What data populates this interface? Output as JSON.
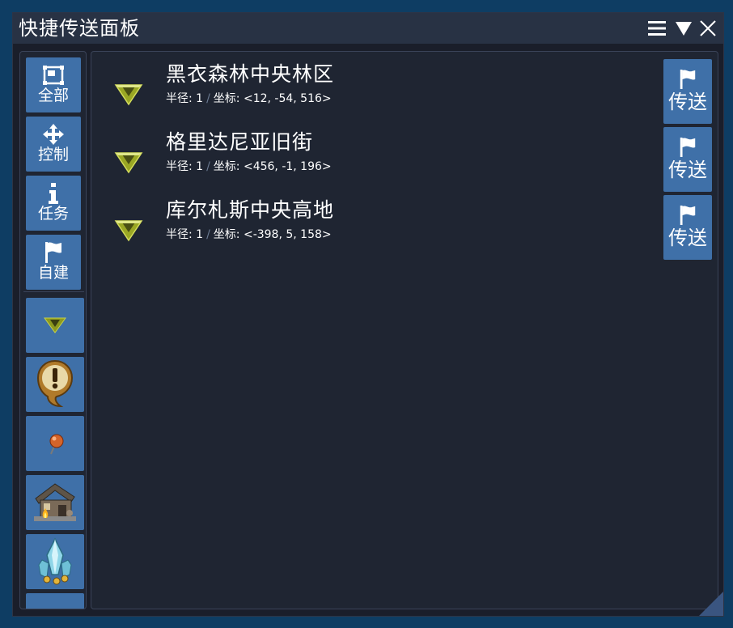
{
  "window": {
    "title": "快捷传送面板"
  },
  "sidebar": {
    "nav": [
      {
        "label": "全部",
        "icon": "select-all-icon"
      },
      {
        "label": "控制",
        "icon": "move-arrows-icon"
      },
      {
        "label": "任务",
        "icon": "info-icon"
      },
      {
        "label": "自建",
        "icon": "flag-icon"
      }
    ],
    "categories": [
      {
        "icon": "waypoint-arrow-icon"
      },
      {
        "icon": "quest-exclamation-icon"
      },
      {
        "icon": "map-pin-icon"
      },
      {
        "icon": "house-icon"
      },
      {
        "icon": "crystal-icon"
      }
    ]
  },
  "waypoints": [
    {
      "name": "黑衣森林中央林区",
      "radius_label": "半径: 1",
      "sep": "/",
      "coord_label": "坐标: <12, -54, 516>",
      "button_label": "传送"
    },
    {
      "name": "格里达尼亚旧街",
      "radius_label": "半径: 1",
      "sep": "/",
      "coord_label": "坐标: <456, -1, 196>",
      "button_label": "传送"
    },
    {
      "name": "库尔札斯中央高地",
      "radius_label": "半径: 1",
      "sep": "/",
      "coord_label": "坐标: <-398, 5, 158>",
      "button_label": "传送"
    }
  ],
  "colors": {
    "background": "#0e3d63",
    "panel": "#1f2532",
    "titlebar": "#283244",
    "button": "#3f70a8",
    "waypoint_arrow": "#a8b42a"
  }
}
